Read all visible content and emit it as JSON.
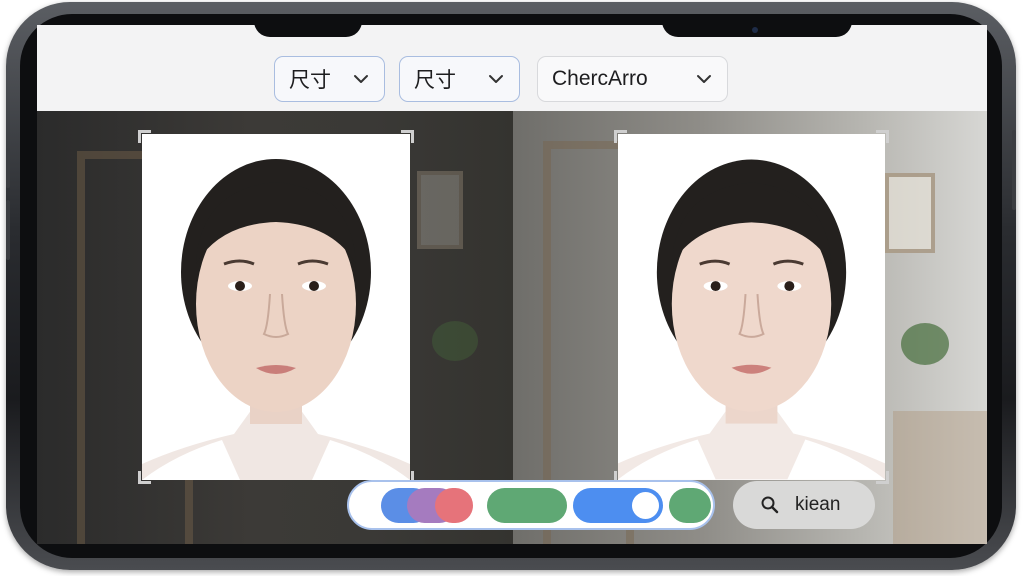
{
  "toolbar": {
    "dropdowns": [
      {
        "label": "尺寸"
      },
      {
        "label": "尺寸"
      },
      {
        "label": "ChercArro"
      }
    ]
  },
  "photos": [
    {
      "name": "original-portrait"
    },
    {
      "name": "processed-portrait"
    }
  ],
  "bottom_controls": {
    "colors": {
      "blue": "#5b8ee6",
      "purple": "#a57bbf",
      "pink": "#e6737a",
      "green": "#5fa874",
      "toggle_blue": "#4d8ef0"
    },
    "search_button": {
      "label": "kiean",
      "icon": "search-icon"
    }
  }
}
